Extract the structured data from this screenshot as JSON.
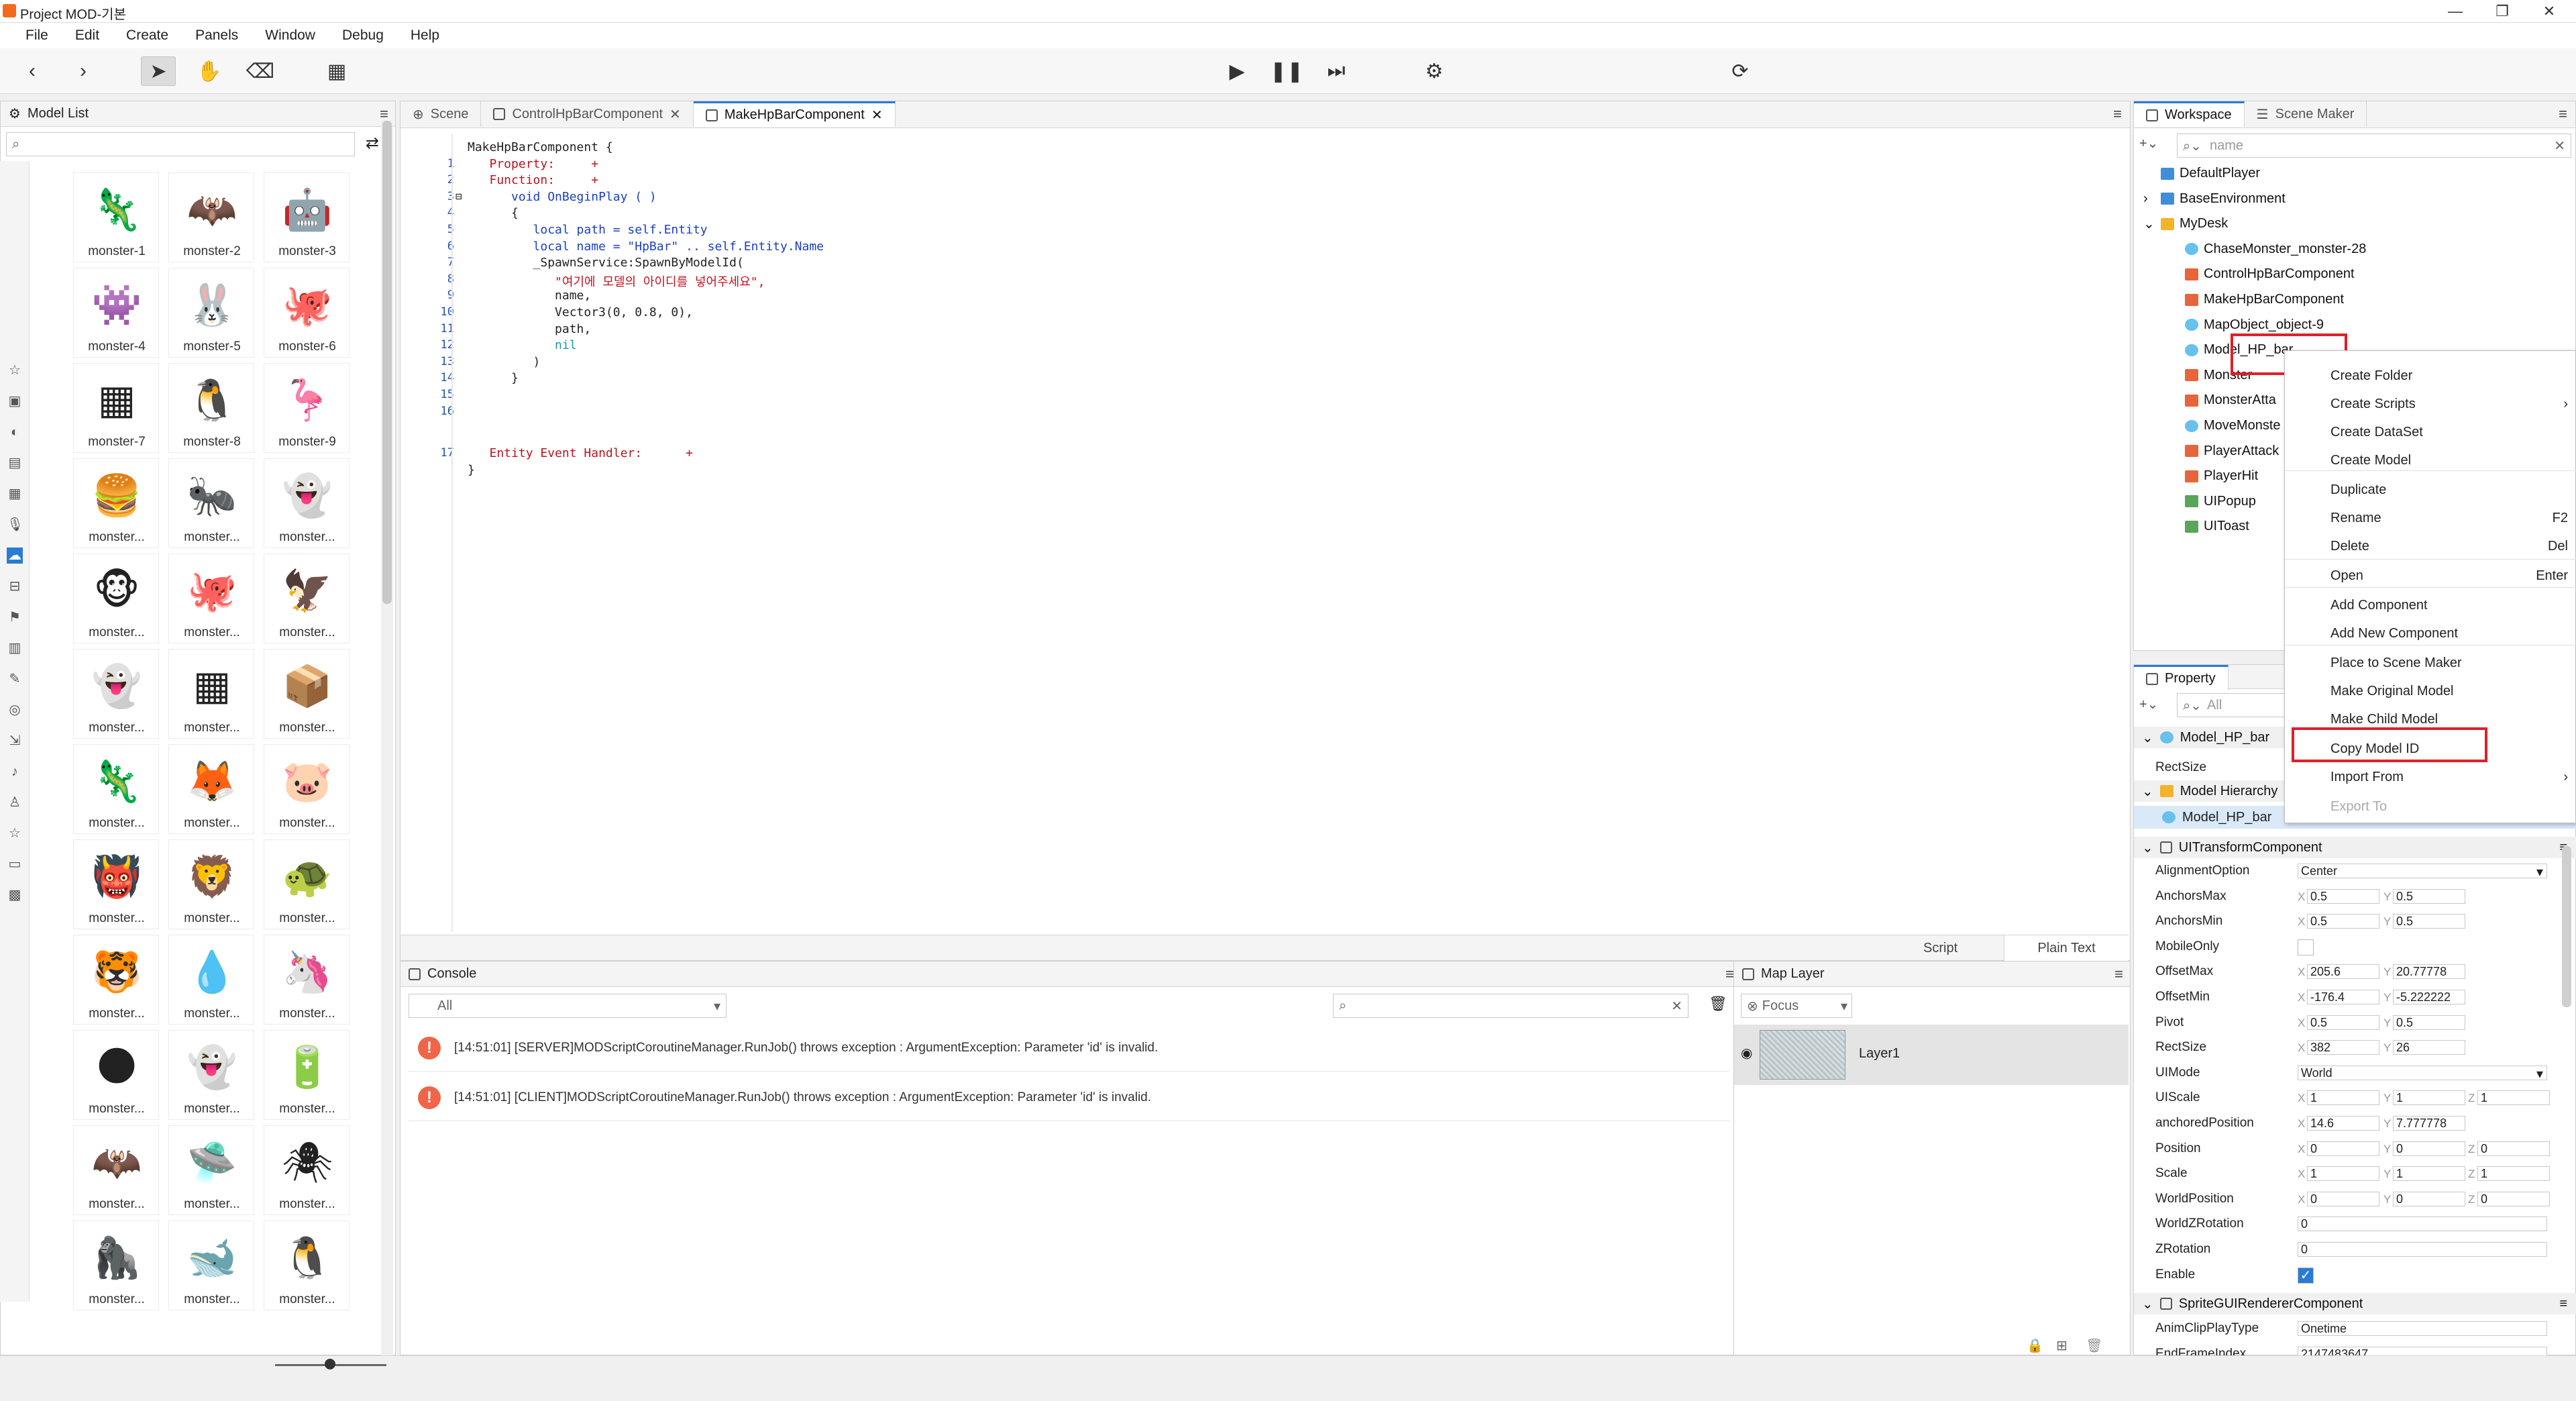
{
  "window": {
    "title": "Project MOD-기본"
  },
  "menu": [
    "File",
    "Edit",
    "Create",
    "Panels",
    "Window",
    "Debug",
    "Help"
  ],
  "model_list": {
    "title": "Model List",
    "items": [
      "monster-1",
      "monster-2",
      "monster-3",
      "monster-4",
      "monster-5",
      "monster-6",
      "monster-7",
      "monster-8",
      "monster-9",
      "monster...",
      "monster...",
      "monster...",
      "monster...",
      "monster...",
      "monster...",
      "monster...",
      "monster...",
      "monster...",
      "monster...",
      "monster...",
      "monster...",
      "monster...",
      "monster...",
      "monster...",
      "monster...",
      "monster...",
      "monster...",
      "monster...",
      "monster...",
      "monster...",
      "monster...",
      "monster...",
      "monster...",
      "monster...",
      "monster...",
      "monster..."
    ]
  },
  "editor": {
    "tabs": [
      "Scene",
      "ControlHpBarComponent",
      "MakeHpBarComponent"
    ],
    "lines": [
      {
        "n": "",
        "t": "MakeHpBarComponent {"
      },
      {
        "n": "1",
        "t": "   Property:     +"
      },
      {
        "n": "2",
        "t": "   Function:     +"
      },
      {
        "n": "3",
        "t": "      void OnBeginPlay ( )"
      },
      {
        "n": "4",
        "t": "      {"
      },
      {
        "n": "5",
        "t": "         local path = self.Entity"
      },
      {
        "n": "6",
        "t": "         local name = \"HpBar\" .. self.Entity.Name"
      },
      {
        "n": "7",
        "t": "         _SpawnService:SpawnByModelId("
      },
      {
        "n": "8",
        "t": "            \"여기에 모델의 아이디를 넣어주세요\","
      },
      {
        "n": "9",
        "t": "            name,"
      },
      {
        "n": "10",
        "t": "            Vector3(0, 0.8, 0),"
      },
      {
        "n": "11",
        "t": "            path,"
      },
      {
        "n": "12",
        "t": "            nil"
      },
      {
        "n": "13",
        "t": "         )"
      },
      {
        "n": "14",
        "t": "      }"
      },
      {
        "n": "15",
        "t": ""
      },
      {
        "n": "16",
        "t": ""
      },
      {
        "n": "17",
        "t": "   Entity Event Handler:      +"
      },
      {
        "n": "",
        "t": "}"
      }
    ],
    "footer_tabs": [
      "Script",
      "Plain Text"
    ]
  },
  "console": {
    "title": "Console",
    "filter": "All",
    "messages": [
      "[14:51:01] [SERVER]MODScriptCoroutineManager.RunJob() throws exception : ArgumentException: Parameter 'id' is invalid.",
      "[14:51:01] [CLIENT]MODScriptCoroutineManager.RunJob() throws exception : ArgumentException: Parameter 'id' is invalid."
    ]
  },
  "map_layer": {
    "title": "Map Layer",
    "focus": "Focus",
    "layer": "Layer1"
  },
  "workspace": {
    "tabs": [
      "Workspace",
      "Scene Maker"
    ],
    "search_placeholder": "name",
    "tree": [
      "DefaultPlayer",
      "BaseEnvironment",
      "MyDesk",
      "ChaseMonster_monster-28",
      "ControlHpBarComponent",
      "MakeHpBarComponent",
      "MapObject_object-9",
      "Model_HP_bar",
      "Monster",
      "MonsterAtta",
      "MoveMonste",
      "PlayerAttack",
      "PlayerHit",
      "UIPopup",
      "UIToast"
    ]
  },
  "context_menu": [
    {
      "label": "Create Folder",
      "key": ""
    },
    {
      "label": "Create Scripts",
      "key": "›"
    },
    {
      "label": "Create DataSet",
      "key": ""
    },
    {
      "label": "Create Model",
      "key": ""
    },
    {
      "label": "Duplicate",
      "key": ""
    },
    {
      "label": "Rename",
      "key": "F2"
    },
    {
      "label": "Delete",
      "key": "Del"
    },
    {
      "label": "Open",
      "key": "Enter"
    },
    {
      "label": "Add Component",
      "key": ""
    },
    {
      "label": "Add New Component",
      "key": ""
    },
    {
      "label": "Place to Scene Maker",
      "key": ""
    },
    {
      "label": "Make Original Model",
      "key": ""
    },
    {
      "label": "Make Child Model",
      "key": ""
    },
    {
      "label": "Copy Model ID",
      "key": ""
    },
    {
      "label": "Import From",
      "key": "›"
    },
    {
      "label": "Export To",
      "key": ""
    }
  ],
  "property": {
    "title": "Property",
    "filter": "All",
    "model": "Model_HP_bar",
    "rectsize_label": "RectSize",
    "hierarchy_label": "Model Hierarchy",
    "hierarchy_item": "Model_HP_bar",
    "component1": "UITransformComponent",
    "rows": [
      {
        "k": "AlignmentOption",
        "v": "Center"
      },
      {
        "k": "AnchorsMax",
        "x": "0.5",
        "y": "0.5"
      },
      {
        "k": "AnchorsMin",
        "x": "0.5",
        "y": "0.5"
      },
      {
        "k": "MobileOnly",
        "v": ""
      },
      {
        "k": "OffsetMax",
        "x": "205.6",
        "y": "20.77778"
      },
      {
        "k": "OffsetMin",
        "x": "-176.4",
        "y": "-5.222222"
      },
      {
        "k": "Pivot",
        "x": "0.5",
        "y": "0.5"
      },
      {
        "k": "RectSize",
        "x": "382",
        "y": "26"
      },
      {
        "k": "UIMode",
        "v": "World"
      },
      {
        "k": "UIScale",
        "x": "1",
        "y": "1",
        "z": "1"
      },
      {
        "k": "anchoredPosition",
        "x": "14.6",
        "y": "7.777778"
      },
      {
        "k": "Position",
        "x": "0",
        "y": "0",
        "z": "0"
      },
      {
        "k": "Scale",
        "x": "1",
        "y": "1",
        "z": "1"
      },
      {
        "k": "WorldPosition",
        "x": "0",
        "y": "0",
        "z": "0"
      },
      {
        "k": "WorldZRotation",
        "v": "0"
      },
      {
        "k": "ZRotation",
        "v": "0"
      },
      {
        "k": "Enable",
        "v": ""
      }
    ],
    "component2": "SpriteGUIRendererComponent",
    "rows2": [
      {
        "k": "AnimClipPlayType",
        "v": "Onetime"
      },
      {
        "k": "EndFrameIndex",
        "v": "2147483647"
      }
    ]
  },
  "colors": {
    "accent": "#2a7bd5",
    "highlight": "#e0202a",
    "error": "#f06548"
  }
}
